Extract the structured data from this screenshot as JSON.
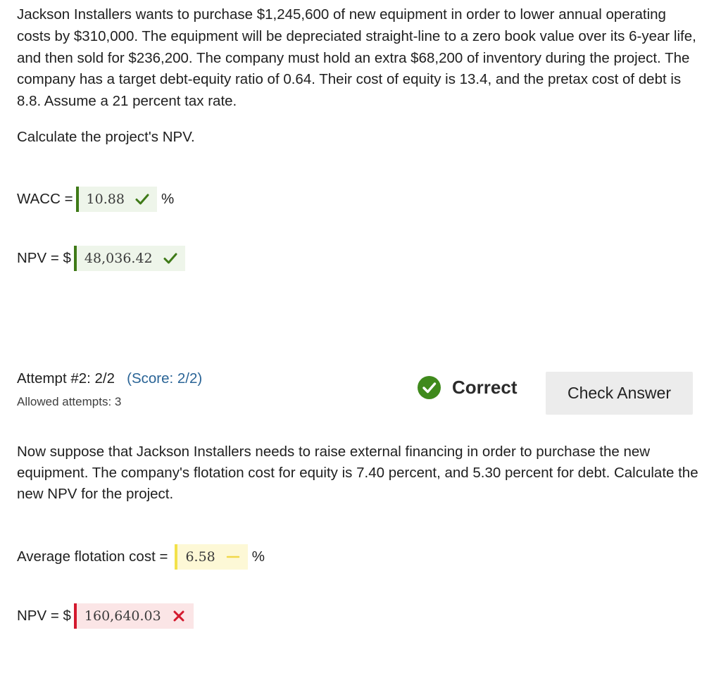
{
  "problem": {
    "text": "Jackson Installers wants to purchase $1,245,600 of new equipment in order to lower annual operating costs by $310,000. The equipment will be depreciated straight-line to a zero book value over its 6-year life, and then sold for $236,200. The company must hold an extra $68,200 of inventory during the project. The company has a target debt-equity ratio of 0.64. Their cost of equity is 13.4, and the pretax cost of debt is 8.8. Assume a 21 percent tax rate.",
    "question": "Calculate the project's NPV."
  },
  "part1": {
    "wacc": {
      "label": "WACC =",
      "value": "10.88",
      "status": "correct",
      "unit": "%"
    },
    "npv": {
      "label": "NPV = $",
      "value": "48,036.42",
      "status": "correct"
    }
  },
  "attempt": {
    "label": "Attempt #2: 2/2",
    "score": "(Score: 2/2)",
    "allowed": "Allowed attempts: 3",
    "status_text": "Correct",
    "check_button": "Check Answer"
  },
  "part2": {
    "question": "Now suppose that Jackson Installers needs to raise external financing in order to purchase the new equipment. The company's flotation cost for equity is 7.40 percent, and 5.30 percent for debt. Calculate the new NPV for the project.",
    "flotation": {
      "label": "Average flotation cost =",
      "value": "6.58",
      "status": "partial",
      "unit": "%"
    },
    "npv": {
      "label": "NPV = $",
      "value": "160,640.03",
      "status": "incorrect"
    }
  },
  "colors": {
    "correct": "#3f7a18",
    "partial": "#f3e14a",
    "incorrect": "#d3192e",
    "score_link": "#2a6496"
  },
  "icons": {
    "correct_mark": "checkmark-icon",
    "partial_mark": "dash-icon",
    "incorrect_mark": "x-mark-icon",
    "status": "check-circle-icon"
  }
}
